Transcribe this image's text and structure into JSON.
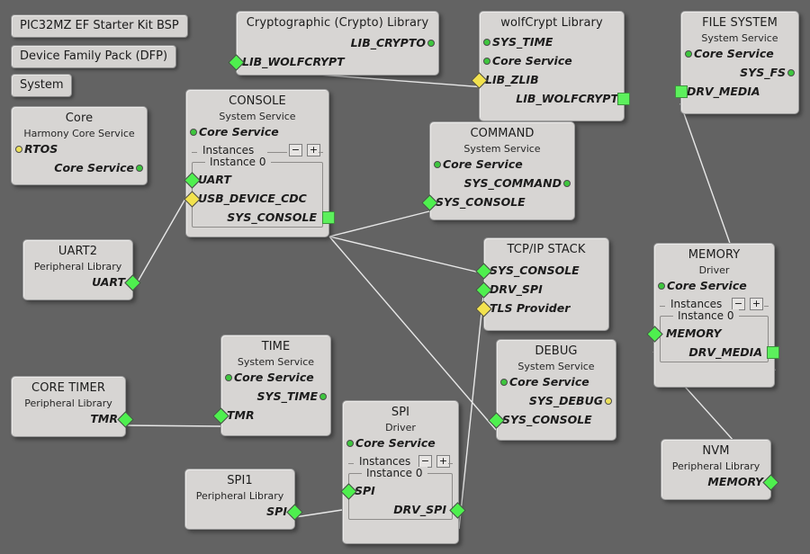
{
  "toolbar": {
    "buttons": [
      {
        "label": "PIC32MZ EF Starter Kit BSP"
      },
      {
        "label": "Device Family Pack (DFP)"
      },
      {
        "label": "System"
      }
    ]
  },
  "nodes": {
    "core": {
      "title": "Core",
      "subtitle": "Harmony Core Service",
      "rows": [
        {
          "label": "RTOS",
          "marker": "dot-yellow-left"
        },
        {
          "label": "Core Service",
          "marker": "dot-green-right"
        }
      ]
    },
    "crypto": {
      "title": "Cryptographic (Crypto) Library",
      "subtitle": "",
      "rows": [
        {
          "label": "LIB_CRYPTO",
          "marker": "dot-green-right"
        },
        {
          "label": "LIB_WOLFCRYPT",
          "marker": "diamond-green-left"
        }
      ]
    },
    "wolfcrypt": {
      "title": "wolfCrypt Library",
      "subtitle": "",
      "rows": [
        {
          "label": "SYS_TIME",
          "marker": "dot-green-left"
        },
        {
          "label": "Core Service",
          "marker": "dot-green-left"
        },
        {
          "label": "LIB_ZLIB",
          "marker": "diamond-yellow-left"
        },
        {
          "label": "LIB_WOLFCRYPT",
          "marker": "square-green-right"
        }
      ]
    },
    "filesystem": {
      "title": "FILE SYSTEM",
      "subtitle": "System Service",
      "rows": [
        {
          "label": "Core Service",
          "marker": "dot-green-left"
        },
        {
          "label": "SYS_FS",
          "marker": "dot-green-right"
        },
        {
          "label": "DRV_MEDIA",
          "marker": "square-green-left"
        }
      ]
    },
    "console": {
      "title": "CONSOLE",
      "subtitle": "System Service",
      "rows": [
        {
          "label": "Core Service",
          "marker": "dot-green-left"
        }
      ],
      "instances_label": "Instances",
      "minus": "−",
      "plus": "+",
      "instance_caption": "Instance 0",
      "instance_rows": [
        {
          "label": "UART",
          "marker": "diamond-green-left"
        },
        {
          "label": "USB_DEVICE_CDC",
          "marker": "diamond-yellow-left"
        },
        {
          "label": "SYS_CONSOLE",
          "marker": "square-green-right"
        }
      ]
    },
    "command": {
      "title": "COMMAND",
      "subtitle": "System Service",
      "rows": [
        {
          "label": "Core Service",
          "marker": "dot-green-left"
        },
        {
          "label": "SYS_COMMAND",
          "marker": "dot-green-right"
        },
        {
          "label": "SYS_CONSOLE",
          "marker": "diamond-green-left"
        }
      ]
    },
    "tcpip": {
      "title": "TCP/IP STACK",
      "subtitle": "",
      "rows": [
        {
          "label": "SYS_CONSOLE",
          "marker": "diamond-green-left"
        },
        {
          "label": "DRV_SPI",
          "marker": "diamond-green-left"
        },
        {
          "label": "TLS Provider",
          "marker": "diamond-yellow-left"
        }
      ]
    },
    "debug": {
      "title": "DEBUG",
      "subtitle": "System Service",
      "rows": [
        {
          "label": "Core Service",
          "marker": "dot-green-left"
        },
        {
          "label": "SYS_DEBUG",
          "marker": "dot-yellow-right"
        },
        {
          "label": "SYS_CONSOLE",
          "marker": "diamond-green-left"
        }
      ]
    },
    "uart2": {
      "title": "UART2",
      "subtitle": "Peripheral Library",
      "rows": [
        {
          "label": "UART",
          "marker": "diamond-green-right"
        }
      ]
    },
    "coretimer": {
      "title": "CORE TIMER",
      "subtitle": "Peripheral Library",
      "rows": [
        {
          "label": "TMR",
          "marker": "diamond-green-right"
        }
      ]
    },
    "time": {
      "title": "TIME",
      "subtitle": "System Service",
      "rows": [
        {
          "label": "Core Service",
          "marker": "dot-green-left"
        },
        {
          "label": "SYS_TIME",
          "marker": "dot-green-right"
        },
        {
          "label": "TMR",
          "marker": "diamond-green-left"
        }
      ]
    },
    "spi": {
      "title": "SPI",
      "subtitle": "Driver",
      "rows": [
        {
          "label": "Core Service",
          "marker": "dot-green-left"
        }
      ],
      "instances_label": "Instances",
      "minus": "−",
      "plus": "+",
      "instance_caption": "Instance 0",
      "instance_rows": [
        {
          "label": "SPI",
          "marker": "diamond-green-left"
        },
        {
          "label": "DRV_SPI",
          "marker": "diamond-green-right"
        }
      ]
    },
    "spi1": {
      "title": "SPI1",
      "subtitle": "Peripheral Library",
      "rows": [
        {
          "label": "SPI",
          "marker": "diamond-green-right"
        }
      ]
    },
    "memory": {
      "title": "MEMORY",
      "subtitle": "Driver",
      "rows": [
        {
          "label": "Core Service",
          "marker": "dot-green-left"
        }
      ],
      "instances_label": "Instances",
      "minus": "−",
      "plus": "+",
      "instance_caption": "Instance 0",
      "instance_rows": [
        {
          "label": "MEMORY",
          "marker": "diamond-green-left"
        },
        {
          "label": "DRV_MEDIA",
          "marker": "square-green-right"
        }
      ]
    },
    "nvm": {
      "title": "NVM",
      "subtitle": "Peripheral Library",
      "rows": [
        {
          "label": "MEMORY",
          "marker": "diamond-green-right"
        }
      ]
    }
  },
  "colors": {
    "background": "#636363",
    "node_fill": "#d7d5d3",
    "node_border": "#9a9a9a",
    "connector_green": "#4ef04e",
    "connector_yellow": "#f2e24e",
    "edge_line": "#e8e8e8"
  },
  "edges": [
    {
      "from": "wolfcrypt.LIB_ZLIB",
      "to": "crypto.LIB_WOLFCRYPT"
    },
    {
      "from": "filesystem.DRV_MEDIA",
      "to": "memory.DRV_MEDIA"
    },
    {
      "from": "console.SYS_CONSOLE",
      "to": "command.SYS_CONSOLE"
    },
    {
      "from": "console.SYS_CONSOLE",
      "to": "tcpip.SYS_CONSOLE"
    },
    {
      "from": "console.SYS_CONSOLE",
      "to": "debug.SYS_CONSOLE"
    },
    {
      "from": "console.UART",
      "to": "uart2.UART"
    },
    {
      "from": "coretimer.TMR",
      "to": "time.TMR"
    },
    {
      "from": "spi1.SPI",
      "to": "spi.SPI"
    },
    {
      "from": "spi.DRV_SPI",
      "to": "tcpip.DRV_SPI"
    },
    {
      "from": "memory.MEMORY",
      "to": "nvm.MEMORY"
    }
  ]
}
